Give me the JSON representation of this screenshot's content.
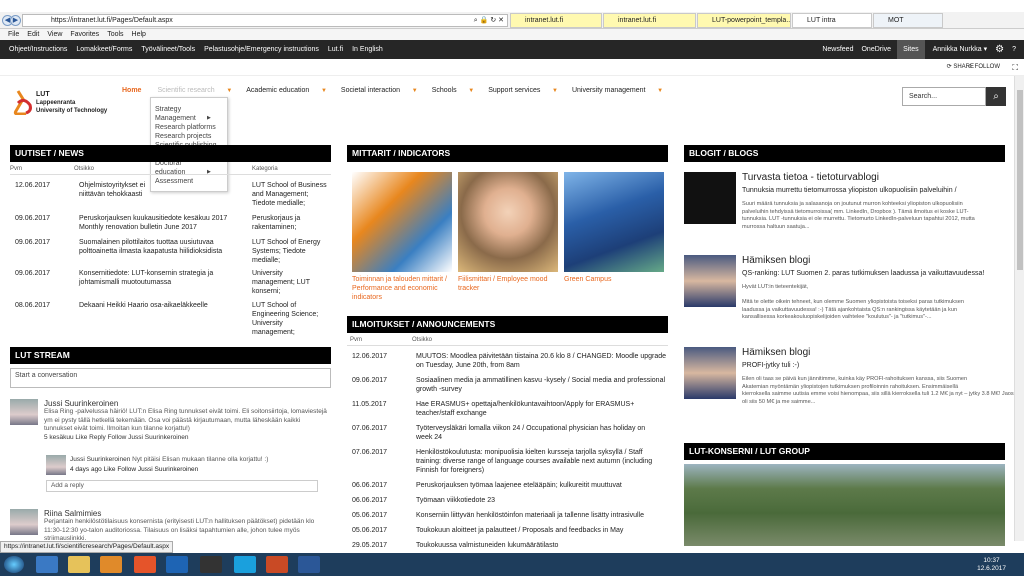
{
  "browser": {
    "url": "https://intranet.lut.fi/Pages/Default.aspx",
    "tabs": [
      {
        "label": "intranet.lut.fi",
        "style": "y"
      },
      {
        "label": "intranet.lut.fi",
        "style": "y"
      },
      {
        "label": "LUT-powerpoint_templa...",
        "style": "y"
      },
      {
        "label": "LUT intra",
        "style": "act"
      },
      {
        "label": "MOT",
        "style": "n"
      }
    ],
    "menu": [
      "File",
      "Edit",
      "View",
      "Favorites",
      "Tools",
      "Help"
    ]
  },
  "suite": {
    "links": [
      "Ohjeet/Instructions",
      "Lomakkeet/Forms",
      "Työvälineet/Tools",
      "Pelastusohje/Emergency instructions",
      "Lut.fi",
      "In English"
    ],
    "right": [
      "Newsfeed",
      "OneDrive",
      "Sites"
    ],
    "user": "Annikka Nurkka",
    "share": "SHARE",
    "follow": "FOLLOW"
  },
  "logo": {
    "name": "LUT",
    "line1": "Lappeenranta",
    "line2": "University of Technology"
  },
  "topnav": [
    {
      "label": "Home",
      "active": true
    },
    {
      "label": "Scientific research"
    },
    {
      "label": "Academic education"
    },
    {
      "label": "Societal interaction"
    },
    {
      "label": "Schools"
    },
    {
      "label": "Support services"
    },
    {
      "label": "University management"
    }
  ],
  "dropdown": [
    "Strategy",
    "Management",
    "Research platforms",
    "Research projects",
    "Scientific publishing",
    "Researcher career",
    "Doctoral",
    "education",
    "Assessment"
  ],
  "search": {
    "placeholder": "Search..."
  },
  "news": {
    "title": "UUTISET / NEWS",
    "headers": [
      "Pvm",
      "Otsikko",
      "Kategoria"
    ],
    "rows": [
      {
        "date": "12.06.2017",
        "title": "Ohjelmistoyritykset ei\nniittävän tehokkaasti",
        "cat": "LUT School of Business\nand Management;\nTiedote medialle;"
      },
      {
        "date": "09.06.2017",
        "title": "Peruskorjauksen kuukausitiedote kesäkuu 2017\nMonthly renovation bulletin June 2017",
        "cat": "Peruskorjaus ja\nrakentaminen;"
      },
      {
        "date": "09.06.2017",
        "title": "Suomalainen pilottilaitos tuottaa uusiutuvaa\npolttoainetta ilmasta kaapatusta hiilidioksidista",
        "cat": "LUT School of Energy\nSystems; Tiedote\nmedialle;"
      },
      {
        "date": "09.06.2017",
        "title": "Konsernitiedote: LUT-konsernin strategia ja\njohtamismalli muotoutumassa",
        "cat": "University\nmanagement; LUT\nkonserni;"
      },
      {
        "date": "08.06.2017",
        "title": "Dekaani Heikki Haario osa-aikaeläkkeelle",
        "cat": "LUT School of\nEngineering Science;\nUniversity\nmanagement;"
      }
    ]
  },
  "stream": {
    "title": "LUT STREAM",
    "placeholder": "Start a conversation",
    "posts": [
      {
        "author": "Jussi Suurinkeroinen",
        "text": "Elisa Ring -palvelussa häiriö! LUT:n Elisa Ring tunnukset eivät toimi. Eli soitonsiirtoja, lomaviestejä\nym ei pysty tällä hetkellä tekemään. Osa voi päästä kirjautumaan, mutta läheskään kaikki\ntunnukset eivät toimi. Ilmoitan kun tilanne korjattu!)",
        "meta": "5 kesäkuu   Like   Reply   Follow Jussi Suurinkeroinen"
      },
      {
        "author": "Jussi Suurinkeroinen",
        "text": "Nyt pitäisi Elisan mukaan tilanne olla korjattu! :)",
        "meta": "4 days ago   Like   Follow Jussi Suurinkeroinen"
      },
      {
        "reply": "Add a reply"
      },
      {
        "author": "Riina Salmimies",
        "text": "Perjantain henkilöstötilaisuus konsernista (erityisesti LUT:n hallituksen päätökset) pidetään klo\n11:30-12:30 yo-talon auditoriossa. Tilaisuus on lisäksi tapahtumien alle, johon tulee myös\nstriimauslinkki."
      }
    ]
  },
  "indicators": {
    "title": "MITTARIT / INDICATORS",
    "items": [
      "Toiminnan ja talouden mittarit /\nPerformance and economic\nindicators",
      "Fiilismittari / Employee mood\ntracker",
      "Green Campus"
    ]
  },
  "announcements": {
    "title": "ILMOITUKSET / ANNOUNCEMENTS",
    "headers": [
      "Pvm",
      "Otsikko"
    ],
    "rows": [
      {
        "date": "12.06.2017",
        "title": "MUUTOS: Moodlea päivitetään tiistaina 20.6 klo 8 / CHANGED: Moodle upgrade\non Tuesday, June 20th, from 8am"
      },
      {
        "date": "09.06.2017",
        "title": "Sosiaalinen media ja ammatillinen kasvu -kysely / Social media and professional\ngrowth -survey"
      },
      {
        "date": "11.05.2017",
        "title": "Hae ERASMUS+ opettaja/henkilökuntavaihtoon/Apply for ERASMUS+\nteacher/staff exchange"
      },
      {
        "date": "07.06.2017",
        "title": "Työterveysläkäri lomalla viikon 24 / Occupational physician has holiday on\nweek 24"
      },
      {
        "date": "07.06.2017",
        "title": "Henkilöstökoulutusta: monipuolisia kielten kursseja tarjolla syksyllä / Staff\ntraining: diverse range of language courses available next autumn (including\nFinnish for foreigners)"
      },
      {
        "date": "06.06.2017",
        "title": "Peruskorjauksen työmaa laajenee etelääpäin; kulkureitit muuttuvat"
      },
      {
        "date": "06.06.2017",
        "title": "Työmaan viikkotiedote 23"
      },
      {
        "date": "05.06.2017",
        "title": "Konserniin liittyvän henkilöstöinfon materiaali ja tallenne lisätty intrasivulle"
      },
      {
        "date": "05.06.2017",
        "title": "Toukokuun aloitteet ja palautteet / Proposals and feedbacks in May"
      },
      {
        "date": "29.05.2017",
        "title": "Toukokuussa valmistuneiden lukumäärätilasto"
      }
    ]
  },
  "blogs": {
    "title": "BLOGIT / BLOGS",
    "items": [
      {
        "title": "Turvasta tietoa - tietoturvablogi",
        "sub": "Tunnuksia murrettu tietomurrossa yliopiston ulkopuolisiin palveluihin /",
        "body": "Suuri määrä tunnuksia ja salasanoja on joutunut murron kohteeksi yliopiston ulkopuolisiin\npalveluihin tehdyissä tietomurroissa( mm. LinkedIn, Dropbox ). Tämä ilmoitus ei koske LUT-\ntunnuksia. LUT -tunnuksia ei ole murrettu. Tietomurto LinkedIn-palveluun tapahtui 2012, mutta\nmurrossa haltuun saatuja..."
      },
      {
        "title": "Hämiksen blogi",
        "sub": "QS-ranking: LUT Suomen 2. paras tutkimuksen laadussa ja vaikuttavuudessa!",
        "body": "Hyvät LUT:in tieteentekijät,\n\nMitä te olette oikein tehneet, kun olemme Suomen yliopistoista toiseksi paras tutkimuksen\nlaadussa ja vaikuttavuudessa! :-) Tätä ajankohtaista QS:n rankingissa käytetään ja kun\nkansallisessa korkeakouluopiskelijoiden vaihtelee \"koulutus\"- ja \"tutkimus\"-..."
      },
      {
        "title": "Hämiksen blogi",
        "sub": "PROFI-jytky tuli :-)",
        "body": "Eilen oli taas se päivä kun jännitimme, kuinka käy PROFI-rahoituksen kanssa, siis Suomen\nAkatemian myöntämän yliopistojen tutkimuksen profiloinnin rahoituksen. Ensimmäisellä\nkierroksella saimme uutisia emme voisi hienompaa, siis sillä kierroksella tuli 1.2 M€ ja nyt – jytky 3.8 M€! Jaossa\noli siis 50 M€ ja me saimme..."
      }
    ]
  },
  "group": {
    "title": "LUT-KONSERNI / LUT GROUP"
  },
  "status": {
    "url": "https://intranet.lut.fi/scientificresearch/Pages/Default.aspx"
  },
  "clock": {
    "time": "10:37",
    "date": "12.6.2017"
  }
}
